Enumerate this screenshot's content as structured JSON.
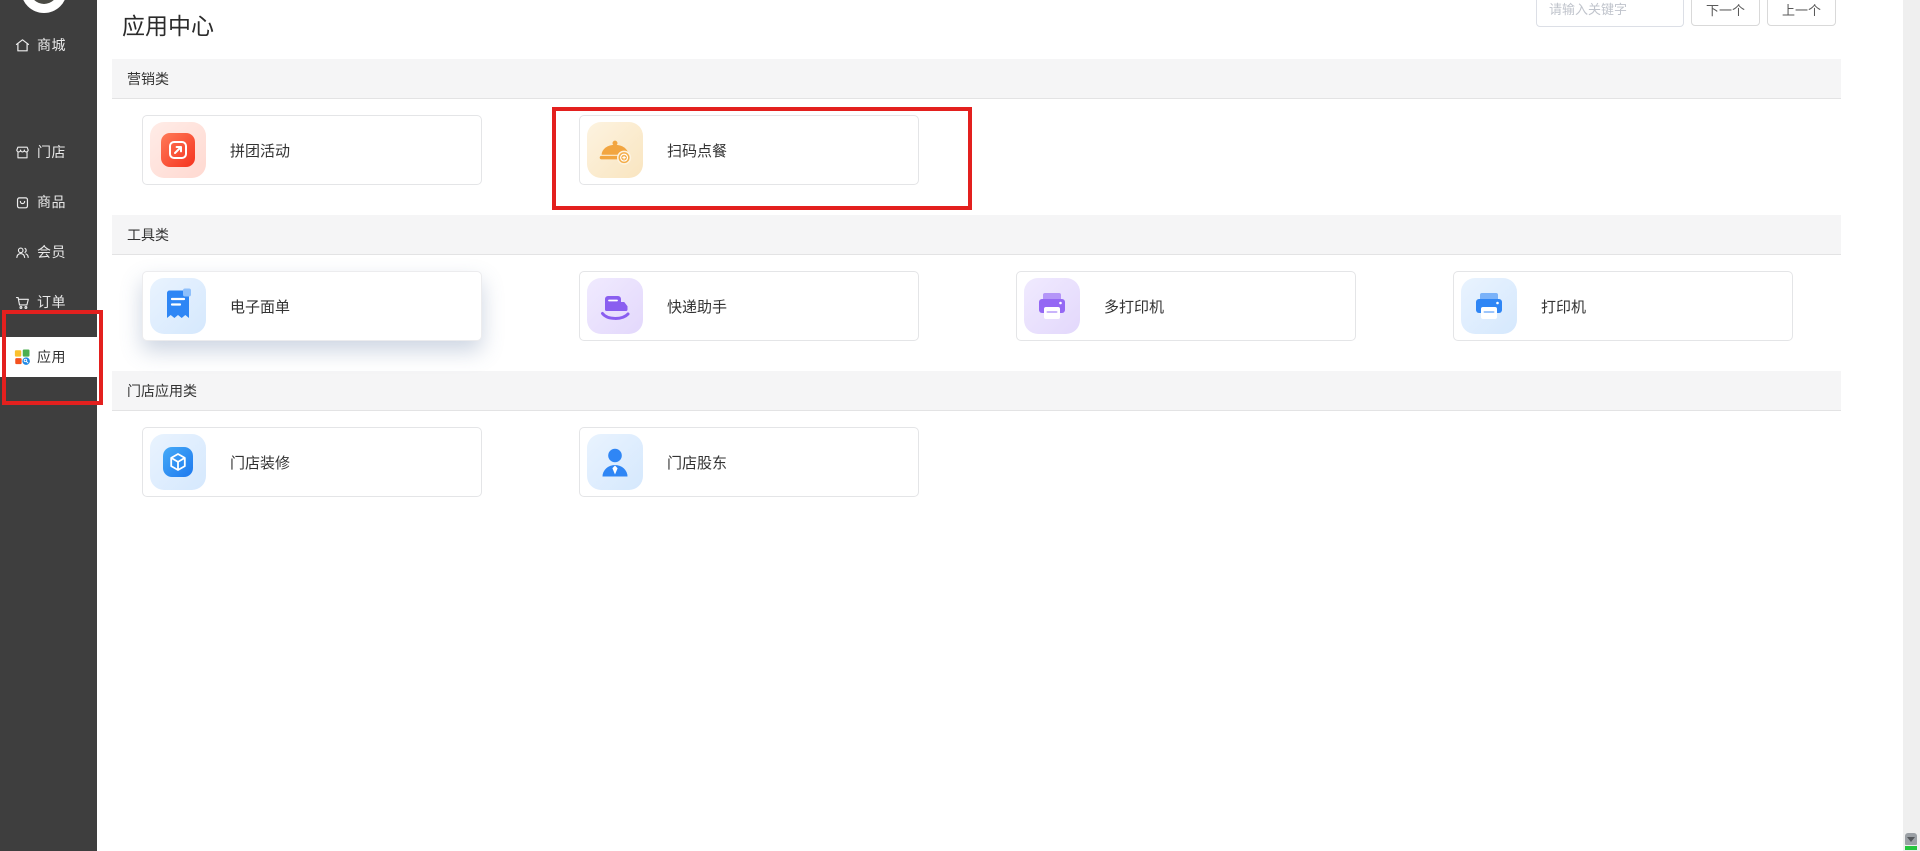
{
  "app": {
    "title": "应用中心",
    "search_placeholder": "请输入关键字",
    "next_button": "下一个",
    "prev_button": "上一个"
  },
  "sidebar": {
    "items": [
      {
        "label": "商城"
      },
      {
        "label": "门店"
      },
      {
        "label": "商品"
      },
      {
        "label": "会员"
      },
      {
        "label": "订单"
      },
      {
        "label": "应用"
      }
    ],
    "selected": "应用"
  },
  "sections": [
    {
      "title": "营销类",
      "apps": [
        {
          "name": "拼团活动"
        },
        {
          "name": "扫码点餐"
        }
      ]
    },
    {
      "title": "工具类",
      "apps": [
        {
          "name": "电子面单"
        },
        {
          "name": "快递助手"
        },
        {
          "name": "多打印机"
        },
        {
          "name": "打印机"
        }
      ]
    },
    {
      "title": "门店应用类",
      "apps": [
        {
          "name": "门店装修"
        },
        {
          "name": "门店股东"
        }
      ]
    }
  ],
  "annotations": {
    "color": "#e3201e",
    "targets": [
      "scan-order-card",
      "sidebar-apps-item"
    ]
  },
  "colors": {
    "sidebar_bg": "#3e3e3e",
    "section_bar_bg": "#f5f5f6",
    "tile_red_icon": "#f8472e",
    "tile_orange_icon": "#f2a540",
    "tile_blue_icon": "#2f86f5",
    "tile_purple_icon": "#9468f4"
  }
}
